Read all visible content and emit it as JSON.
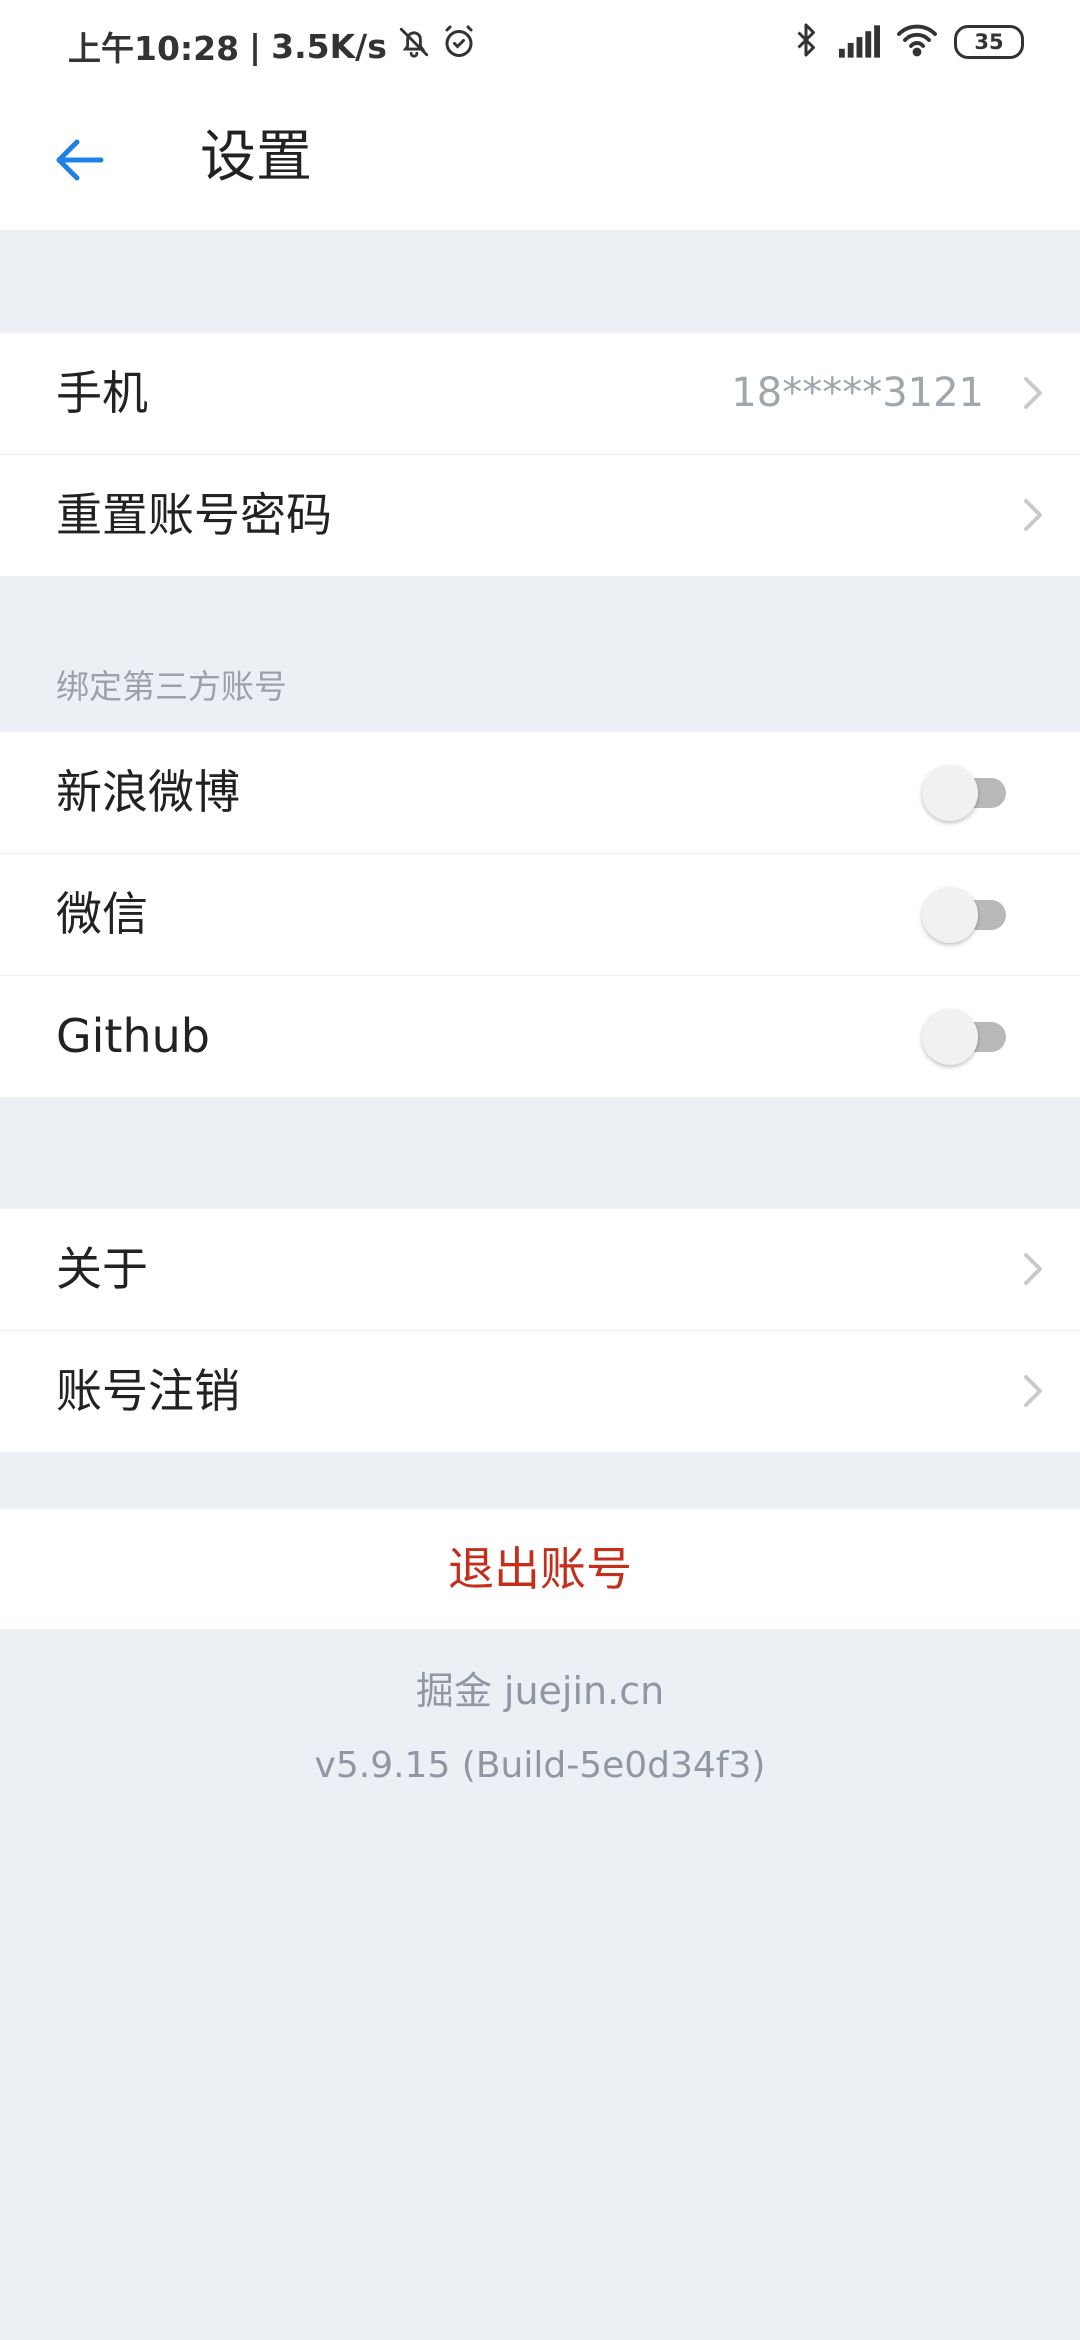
{
  "status_bar": {
    "time": "上午10:28",
    "separator": "|",
    "net_speed": "3.5K/s",
    "battery_level": "35",
    "icons": [
      "bell-off-icon",
      "alarm-icon",
      "bluetooth-icon",
      "signal-icon",
      "wifi-icon",
      "battery-icon"
    ]
  },
  "header": {
    "title": "设置",
    "accent_color": "#1e80e8"
  },
  "account_section": {
    "items": [
      {
        "label": "手机",
        "value": "18*****3121"
      },
      {
        "label": "重置账号密码",
        "value": ""
      }
    ]
  },
  "third_party_section": {
    "title": "绑定第三方账号",
    "items": [
      {
        "label": "新浪微博",
        "enabled": false
      },
      {
        "label": "微信",
        "enabled": false
      },
      {
        "label": "Github",
        "enabled": false
      }
    ]
  },
  "misc_section": {
    "items": [
      {
        "label": "关于"
      },
      {
        "label": "账号注销"
      }
    ]
  },
  "logout": {
    "label": "退出账号",
    "color": "#c62e1c"
  },
  "footer": {
    "brand": "掘金 juejin.cn",
    "version": "v5.9.15 (Build-5e0d34f3)"
  }
}
